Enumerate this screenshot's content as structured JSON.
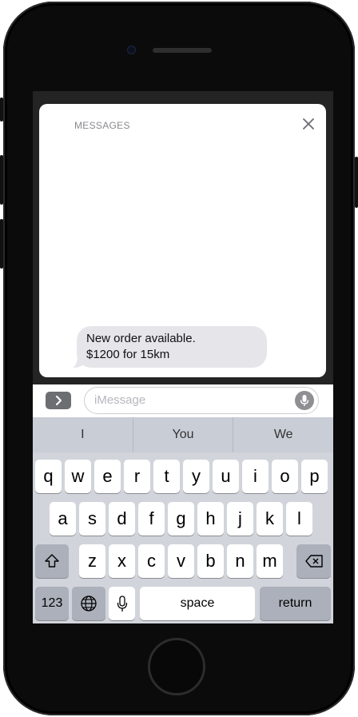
{
  "notification": {
    "app_name": "MESSAGES",
    "message_line1": "New order available.",
    "message_line2": "$1200 for 15km"
  },
  "compose": {
    "placeholder": "iMessage"
  },
  "keyboard": {
    "suggestions": [
      "I",
      "You",
      "We"
    ],
    "row1": [
      "q",
      "w",
      "e",
      "r",
      "t",
      "y",
      "u",
      "i",
      "o",
      "p"
    ],
    "row2": [
      "a",
      "s",
      "d",
      "f",
      "g",
      "h",
      "j",
      "k",
      "l"
    ],
    "row3": [
      "z",
      "x",
      "c",
      "v",
      "b",
      "n",
      "m"
    ],
    "numbers_label": "123",
    "space_label": "space",
    "return_label": "return"
  },
  "icons": {
    "close": "close-icon",
    "apps": "chevron-right-icon",
    "mic": "microphone-icon",
    "shift": "shift-icon",
    "delete": "backspace-icon",
    "globe": "globe-icon",
    "dictation": "microphone-icon"
  },
  "colors": {
    "bubble_bg": "#e5e5ea",
    "keyboard_bg": "#d1d4db",
    "special_key_bg": "#abb0ba"
  }
}
